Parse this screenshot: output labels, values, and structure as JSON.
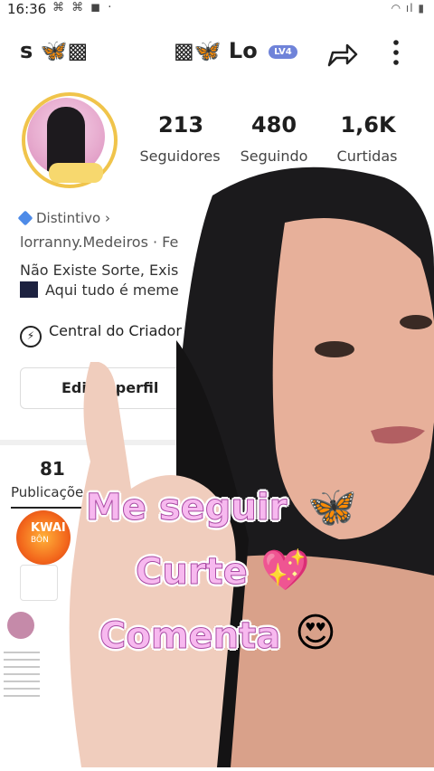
{
  "status_bar": {
    "time": "16:36",
    "left_icons": [
      "pinwheel-icon",
      "pinwheel-icon",
      "bag-icon",
      "dot-icon"
    ],
    "right_icons": [
      "wifi-icon",
      "signal-icon",
      "battery-icon"
    ],
    "left_glyphs": "⌘ ⌘ ◼ ·",
    "right_glyphs": "◠ ıl ▮"
  },
  "header": {
    "left_text": "s 🦋▩",
    "center_text": "▩🦋 Lo",
    "level_badge": "LV4"
  },
  "profile": {
    "stats": [
      {
        "value": "213",
        "label": "Seguidores"
      },
      {
        "value": "480",
        "label": "Seguindo"
      },
      {
        "value": "1,6K",
        "label": "Curtidas"
      }
    ],
    "badge_label": "Distintivo ›",
    "handle": "lorranny.Medeiros · Fe",
    "bio_line1": "Não Existe Sorte, Exis",
    "bio_line2": "Aqui tudo é meme",
    "creator_center": "Central do Criador",
    "edit_profile": "Editar perfil"
  },
  "posts": {
    "count": "81",
    "label": "Publicações",
    "kwai_badge_title": "KWAI",
    "kwai_badge_sub": "BÔN"
  },
  "overlay": {
    "line1": "Me seguir",
    "line1_emoji": "🦋",
    "line2": "Curte",
    "line2_emoji": "💖",
    "line3": "Comenta",
    "line3_emoji": "😍"
  },
  "colors": {
    "overlay_text": "#f7b9ef",
    "overlay_outline": "#a94aa3",
    "level_badge": "#6f83d9",
    "badge_icon": "#4e8be8",
    "avatar_ring": "#f0c44b"
  }
}
